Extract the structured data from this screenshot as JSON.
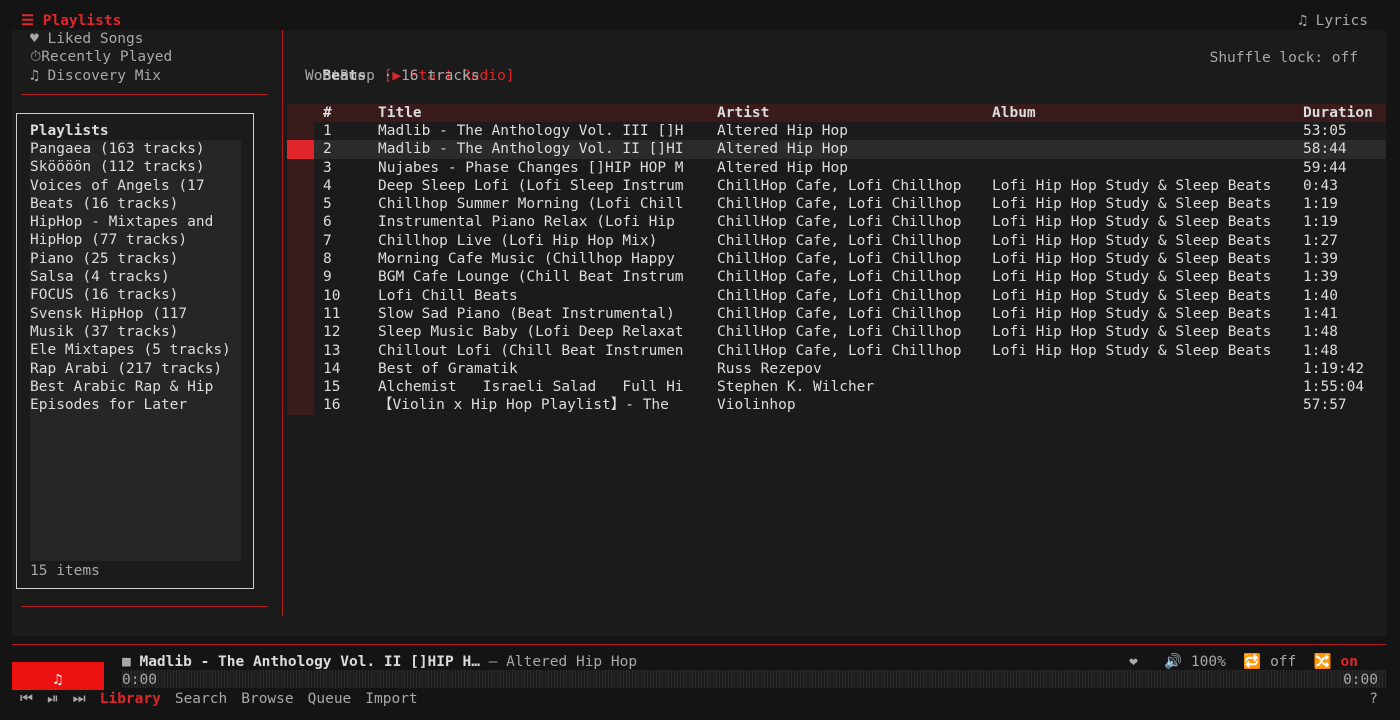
{
  "topbar": {
    "playlists_label": "☰ Playlists",
    "lyrics_label": "♫ Lyrics"
  },
  "shortcuts": [
    "♥ Liked Songs",
    "⏱Recently Played",
    "♫ Discovery Mix"
  ],
  "sidebar": {
    "title": "Playlists",
    "items": [
      "Pangaea (163 tracks)",
      "Sköööön (112 tracks)",
      "Voices of Angels (17",
      "Beats (16 tracks)",
      "HipHop - Mixtapes and",
      "HipHop (77 tracks)",
      "Piano (25 tracks)",
      "Salsa (4 tracks)",
      "FOCUS (16 tracks)",
      "Svensk HipHop (117",
      "Musik (37 tracks)",
      "Ele Mixtapes (5 tracks)",
      "Rap Arabi (217 tracks)",
      "Best Arabic Rap & Hip",
      "Episodes for Later"
    ],
    "count": "15 items"
  },
  "header": {
    "playlist": "Beats",
    "start_radio": "[▶ Start Radio]",
    "subtitle": "WootBoop · 16 tracks",
    "shuffle_lock": "Shuffle lock: off"
  },
  "table": {
    "columns": {
      "num": "#",
      "title": "Title",
      "artist": "Artist",
      "album": "Album",
      "duration": "Duration"
    },
    "rows": [
      {
        "num": "1",
        "title": "Madlib - The Anthology Vol. III []H",
        "artist": "Altered Hip Hop",
        "album": "",
        "duration": "53:05"
      },
      {
        "num": "2",
        "title": "Madlib - The Anthology Vol. II []HI",
        "artist": "Altered Hip Hop",
        "album": "",
        "duration": "58:44"
      },
      {
        "num": "3",
        "title": "Nujabes - Phase Changes []HIP HOP M",
        "artist": "Altered Hip Hop",
        "album": "",
        "duration": "59:44"
      },
      {
        "num": "4",
        "title": "Deep Sleep Lofi (Lofi Sleep Instrum",
        "artist": "ChillHop Cafe, Lofi Chillhop",
        "album": "Lofi Hip Hop Study & Sleep Beats",
        "duration": "0:43"
      },
      {
        "num": "5",
        "title": "Chillhop Summer Morning (Lofi Chill",
        "artist": "ChillHop Cafe, Lofi Chillhop",
        "album": "Lofi Hip Hop Study & Sleep Beats",
        "duration": "1:19"
      },
      {
        "num": "6",
        "title": "Instrumental Piano Relax (Lofi Hip",
        "artist": "ChillHop Cafe, Lofi Chillhop",
        "album": "Lofi Hip Hop Study & Sleep Beats",
        "duration": "1:19"
      },
      {
        "num": "7",
        "title": "Chillhop Live (Lofi Hip Hop Mix)",
        "artist": "ChillHop Cafe, Lofi Chillhop",
        "album": "Lofi Hip Hop Study & Sleep Beats",
        "duration": "1:27"
      },
      {
        "num": "8",
        "title": "Morning Cafe Music (Chillhop Happy",
        "artist": "ChillHop Cafe, Lofi Chillhop",
        "album": "Lofi Hip Hop Study & Sleep Beats",
        "duration": "1:39"
      },
      {
        "num": "9",
        "title": "BGM Cafe Lounge (Chill Beat Instrum",
        "artist": "ChillHop Cafe, Lofi Chillhop",
        "album": "Lofi Hip Hop Study & Sleep Beats",
        "duration": "1:39"
      },
      {
        "num": "10",
        "title": "Lofi Chill Beats",
        "artist": "ChillHop Cafe, Lofi Chillhop",
        "album": "Lofi Hip Hop Study & Sleep Beats",
        "duration": "1:40"
      },
      {
        "num": "11",
        "title": "Slow Sad Piano (Beat Instrumental)",
        "artist": "ChillHop Cafe, Lofi Chillhop",
        "album": "Lofi Hip Hop Study & Sleep Beats",
        "duration": "1:41"
      },
      {
        "num": "12",
        "title": "Sleep Music Baby (Lofi Deep Relaxat",
        "artist": "ChillHop Cafe, Lofi Chillhop",
        "album": "Lofi Hip Hop Study & Sleep Beats",
        "duration": "1:48"
      },
      {
        "num": "13",
        "title": "Chillout Lofi (Chill Beat Instrumen",
        "artist": "ChillHop Cafe, Lofi Chillhop",
        "album": "Lofi Hip Hop Study & Sleep Beats",
        "duration": "1:48"
      },
      {
        "num": "14",
        "title": "Best of Gramatik",
        "artist": "Russ Rezepov",
        "album": "",
        "duration": "1:19:42"
      },
      {
        "num": "15",
        "title": "Alchemist   Israeli Salad   Full Hi",
        "artist": "Stephen K. Wilcher",
        "album": "",
        "duration": "1:55:04"
      },
      {
        "num": "16",
        "title": "【Violin x Hip Hop Playlist】- The",
        "artist": "Violinhop",
        "album": "",
        "duration": "57:57"
      }
    ]
  },
  "now_playing": {
    "art_icon": "♫",
    "state_icon": "■",
    "title": "Madlib - The Anthology Vol. II []HIP H…",
    "artist": "— Altered Hip Hop",
    "like_icon": "❤",
    "volume_icon": "🔊",
    "volume": "100%",
    "repeat_icon": "🔁",
    "repeat": "off",
    "shuffle_icon": "🔀",
    "shuffle": "on",
    "elapsed": "0:00",
    "remaining": "0:00",
    "progress": 0
  },
  "nav": {
    "prev_icon": "⏮",
    "pause_icon": "⏯",
    "next_icon": "⏭",
    "tabs": [
      "Library",
      "Search",
      "Browse",
      "Queue",
      "Import"
    ],
    "help": "?"
  },
  "colors": {
    "accent": "#e0262b",
    "background": "#141414",
    "panel": "#1b1b1b"
  }
}
